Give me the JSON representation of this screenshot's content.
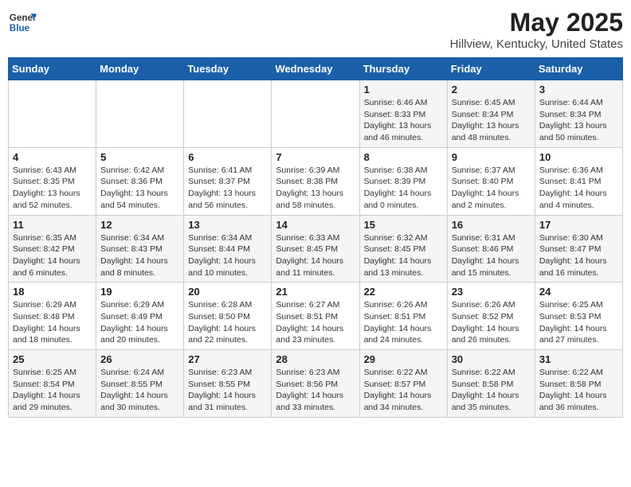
{
  "logo": {
    "general": "General",
    "blue": "Blue"
  },
  "title": "May 2025",
  "subtitle": "Hillview, Kentucky, United States",
  "days_of_week": [
    "Sunday",
    "Monday",
    "Tuesday",
    "Wednesday",
    "Thursday",
    "Friday",
    "Saturday"
  ],
  "weeks": [
    [
      {
        "day": "",
        "info": ""
      },
      {
        "day": "",
        "info": ""
      },
      {
        "day": "",
        "info": ""
      },
      {
        "day": "",
        "info": ""
      },
      {
        "day": "1",
        "info": "Sunrise: 6:46 AM\nSunset: 8:33 PM\nDaylight: 13 hours and 46 minutes."
      },
      {
        "day": "2",
        "info": "Sunrise: 6:45 AM\nSunset: 8:34 PM\nDaylight: 13 hours and 48 minutes."
      },
      {
        "day": "3",
        "info": "Sunrise: 6:44 AM\nSunset: 8:34 PM\nDaylight: 13 hours and 50 minutes."
      }
    ],
    [
      {
        "day": "4",
        "info": "Sunrise: 6:43 AM\nSunset: 8:35 PM\nDaylight: 13 hours and 52 minutes."
      },
      {
        "day": "5",
        "info": "Sunrise: 6:42 AM\nSunset: 8:36 PM\nDaylight: 13 hours and 54 minutes."
      },
      {
        "day": "6",
        "info": "Sunrise: 6:41 AM\nSunset: 8:37 PM\nDaylight: 13 hours and 56 minutes."
      },
      {
        "day": "7",
        "info": "Sunrise: 6:39 AM\nSunset: 8:38 PM\nDaylight: 13 hours and 58 minutes."
      },
      {
        "day": "8",
        "info": "Sunrise: 6:38 AM\nSunset: 8:39 PM\nDaylight: 14 hours and 0 minutes."
      },
      {
        "day": "9",
        "info": "Sunrise: 6:37 AM\nSunset: 8:40 PM\nDaylight: 14 hours and 2 minutes."
      },
      {
        "day": "10",
        "info": "Sunrise: 6:36 AM\nSunset: 8:41 PM\nDaylight: 14 hours and 4 minutes."
      }
    ],
    [
      {
        "day": "11",
        "info": "Sunrise: 6:35 AM\nSunset: 8:42 PM\nDaylight: 14 hours and 6 minutes."
      },
      {
        "day": "12",
        "info": "Sunrise: 6:34 AM\nSunset: 8:43 PM\nDaylight: 14 hours and 8 minutes."
      },
      {
        "day": "13",
        "info": "Sunrise: 6:34 AM\nSunset: 8:44 PM\nDaylight: 14 hours and 10 minutes."
      },
      {
        "day": "14",
        "info": "Sunrise: 6:33 AM\nSunset: 8:45 PM\nDaylight: 14 hours and 11 minutes."
      },
      {
        "day": "15",
        "info": "Sunrise: 6:32 AM\nSunset: 8:45 PM\nDaylight: 14 hours and 13 minutes."
      },
      {
        "day": "16",
        "info": "Sunrise: 6:31 AM\nSunset: 8:46 PM\nDaylight: 14 hours and 15 minutes."
      },
      {
        "day": "17",
        "info": "Sunrise: 6:30 AM\nSunset: 8:47 PM\nDaylight: 14 hours and 16 minutes."
      }
    ],
    [
      {
        "day": "18",
        "info": "Sunrise: 6:29 AM\nSunset: 8:48 PM\nDaylight: 14 hours and 18 minutes."
      },
      {
        "day": "19",
        "info": "Sunrise: 6:29 AM\nSunset: 8:49 PM\nDaylight: 14 hours and 20 minutes."
      },
      {
        "day": "20",
        "info": "Sunrise: 6:28 AM\nSunset: 8:50 PM\nDaylight: 14 hours and 22 minutes."
      },
      {
        "day": "21",
        "info": "Sunrise: 6:27 AM\nSunset: 8:51 PM\nDaylight: 14 hours and 23 minutes."
      },
      {
        "day": "22",
        "info": "Sunrise: 6:26 AM\nSunset: 8:51 PM\nDaylight: 14 hours and 24 minutes."
      },
      {
        "day": "23",
        "info": "Sunrise: 6:26 AM\nSunset: 8:52 PM\nDaylight: 14 hours and 26 minutes."
      },
      {
        "day": "24",
        "info": "Sunrise: 6:25 AM\nSunset: 8:53 PM\nDaylight: 14 hours and 27 minutes."
      }
    ],
    [
      {
        "day": "25",
        "info": "Sunrise: 6:25 AM\nSunset: 8:54 PM\nDaylight: 14 hours and 29 minutes."
      },
      {
        "day": "26",
        "info": "Sunrise: 6:24 AM\nSunset: 8:55 PM\nDaylight: 14 hours and 30 minutes."
      },
      {
        "day": "27",
        "info": "Sunrise: 6:23 AM\nSunset: 8:55 PM\nDaylight: 14 hours and 31 minutes."
      },
      {
        "day": "28",
        "info": "Sunrise: 6:23 AM\nSunset: 8:56 PM\nDaylight: 14 hours and 33 minutes."
      },
      {
        "day": "29",
        "info": "Sunrise: 6:22 AM\nSunset: 8:57 PM\nDaylight: 14 hours and 34 minutes."
      },
      {
        "day": "30",
        "info": "Sunrise: 6:22 AM\nSunset: 8:58 PM\nDaylight: 14 hours and 35 minutes."
      },
      {
        "day": "31",
        "info": "Sunrise: 6:22 AM\nSunset: 8:58 PM\nDaylight: 14 hours and 36 minutes."
      }
    ]
  ]
}
